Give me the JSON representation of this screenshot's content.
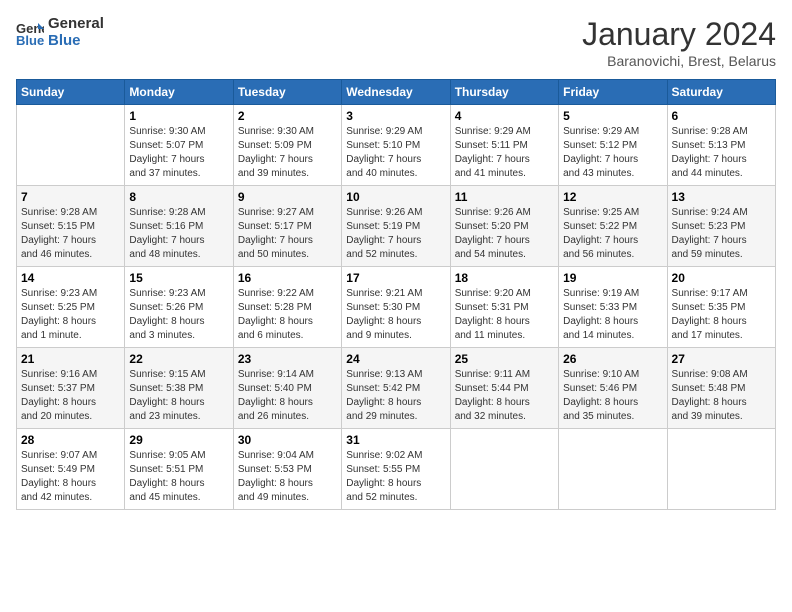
{
  "header": {
    "logo_line1": "General",
    "logo_line2": "Blue",
    "month": "January 2024",
    "location": "Baranovichi, Brest, Belarus"
  },
  "weekdays": [
    "Sunday",
    "Monday",
    "Tuesday",
    "Wednesday",
    "Thursday",
    "Friday",
    "Saturday"
  ],
  "weeks": [
    [
      {
        "day": "",
        "info": ""
      },
      {
        "day": "1",
        "info": "Sunrise: 9:30 AM\nSunset: 5:07 PM\nDaylight: 7 hours\nand 37 minutes."
      },
      {
        "day": "2",
        "info": "Sunrise: 9:30 AM\nSunset: 5:09 PM\nDaylight: 7 hours\nand 39 minutes."
      },
      {
        "day": "3",
        "info": "Sunrise: 9:29 AM\nSunset: 5:10 PM\nDaylight: 7 hours\nand 40 minutes."
      },
      {
        "day": "4",
        "info": "Sunrise: 9:29 AM\nSunset: 5:11 PM\nDaylight: 7 hours\nand 41 minutes."
      },
      {
        "day": "5",
        "info": "Sunrise: 9:29 AM\nSunset: 5:12 PM\nDaylight: 7 hours\nand 43 minutes."
      },
      {
        "day": "6",
        "info": "Sunrise: 9:28 AM\nSunset: 5:13 PM\nDaylight: 7 hours\nand 44 minutes."
      }
    ],
    [
      {
        "day": "7",
        "info": "Sunrise: 9:28 AM\nSunset: 5:15 PM\nDaylight: 7 hours\nand 46 minutes."
      },
      {
        "day": "8",
        "info": "Sunrise: 9:28 AM\nSunset: 5:16 PM\nDaylight: 7 hours\nand 48 minutes."
      },
      {
        "day": "9",
        "info": "Sunrise: 9:27 AM\nSunset: 5:17 PM\nDaylight: 7 hours\nand 50 minutes."
      },
      {
        "day": "10",
        "info": "Sunrise: 9:26 AM\nSunset: 5:19 PM\nDaylight: 7 hours\nand 52 minutes."
      },
      {
        "day": "11",
        "info": "Sunrise: 9:26 AM\nSunset: 5:20 PM\nDaylight: 7 hours\nand 54 minutes."
      },
      {
        "day": "12",
        "info": "Sunrise: 9:25 AM\nSunset: 5:22 PM\nDaylight: 7 hours\nand 56 minutes."
      },
      {
        "day": "13",
        "info": "Sunrise: 9:24 AM\nSunset: 5:23 PM\nDaylight: 7 hours\nand 59 minutes."
      }
    ],
    [
      {
        "day": "14",
        "info": "Sunrise: 9:23 AM\nSunset: 5:25 PM\nDaylight: 8 hours\nand 1 minute."
      },
      {
        "day": "15",
        "info": "Sunrise: 9:23 AM\nSunset: 5:26 PM\nDaylight: 8 hours\nand 3 minutes."
      },
      {
        "day": "16",
        "info": "Sunrise: 9:22 AM\nSunset: 5:28 PM\nDaylight: 8 hours\nand 6 minutes."
      },
      {
        "day": "17",
        "info": "Sunrise: 9:21 AM\nSunset: 5:30 PM\nDaylight: 8 hours\nand 9 minutes."
      },
      {
        "day": "18",
        "info": "Sunrise: 9:20 AM\nSunset: 5:31 PM\nDaylight: 8 hours\nand 11 minutes."
      },
      {
        "day": "19",
        "info": "Sunrise: 9:19 AM\nSunset: 5:33 PM\nDaylight: 8 hours\nand 14 minutes."
      },
      {
        "day": "20",
        "info": "Sunrise: 9:17 AM\nSunset: 5:35 PM\nDaylight: 8 hours\nand 17 minutes."
      }
    ],
    [
      {
        "day": "21",
        "info": "Sunrise: 9:16 AM\nSunset: 5:37 PM\nDaylight: 8 hours\nand 20 minutes."
      },
      {
        "day": "22",
        "info": "Sunrise: 9:15 AM\nSunset: 5:38 PM\nDaylight: 8 hours\nand 23 minutes."
      },
      {
        "day": "23",
        "info": "Sunrise: 9:14 AM\nSunset: 5:40 PM\nDaylight: 8 hours\nand 26 minutes."
      },
      {
        "day": "24",
        "info": "Sunrise: 9:13 AM\nSunset: 5:42 PM\nDaylight: 8 hours\nand 29 minutes."
      },
      {
        "day": "25",
        "info": "Sunrise: 9:11 AM\nSunset: 5:44 PM\nDaylight: 8 hours\nand 32 minutes."
      },
      {
        "day": "26",
        "info": "Sunrise: 9:10 AM\nSunset: 5:46 PM\nDaylight: 8 hours\nand 35 minutes."
      },
      {
        "day": "27",
        "info": "Sunrise: 9:08 AM\nSunset: 5:48 PM\nDaylight: 8 hours\nand 39 minutes."
      }
    ],
    [
      {
        "day": "28",
        "info": "Sunrise: 9:07 AM\nSunset: 5:49 PM\nDaylight: 8 hours\nand 42 minutes."
      },
      {
        "day": "29",
        "info": "Sunrise: 9:05 AM\nSunset: 5:51 PM\nDaylight: 8 hours\nand 45 minutes."
      },
      {
        "day": "30",
        "info": "Sunrise: 9:04 AM\nSunset: 5:53 PM\nDaylight: 8 hours\nand 49 minutes."
      },
      {
        "day": "31",
        "info": "Sunrise: 9:02 AM\nSunset: 5:55 PM\nDaylight: 8 hours\nand 52 minutes."
      },
      {
        "day": "",
        "info": ""
      },
      {
        "day": "",
        "info": ""
      },
      {
        "day": "",
        "info": ""
      }
    ]
  ]
}
